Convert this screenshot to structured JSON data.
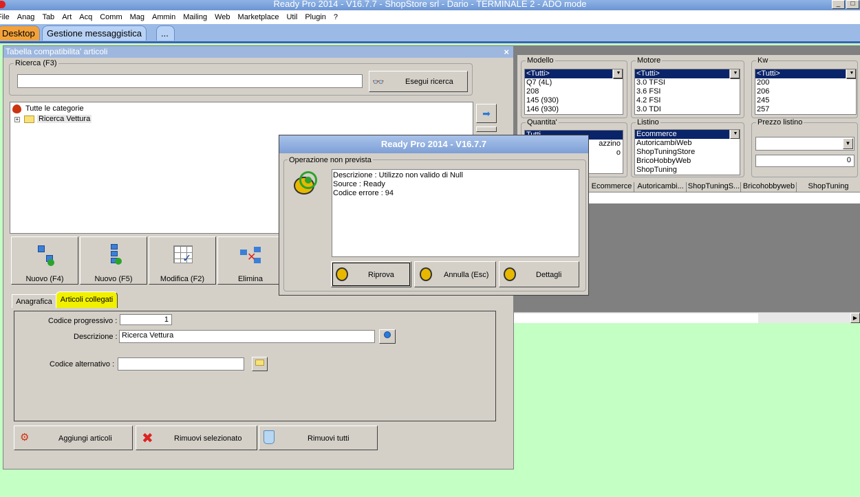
{
  "app_title": "Ready Pro 2014 - V16.7.7 - ShopStore srl - Dario - TERMINALE 2 - ADO mode",
  "menu": [
    "File",
    "Anag",
    "Tab",
    "Art",
    "Acq",
    "Comm",
    "Mag",
    "Ammin",
    "Mailing",
    "Web",
    "Marketplace",
    "Util",
    "Plugin",
    "?"
  ],
  "tabs": {
    "desktop": "Desktop",
    "messaggistica": "Gestione messaggistica",
    "more": "..."
  },
  "main_window": {
    "title": "Tabella compatibilita' articoli",
    "close": "×"
  },
  "search": {
    "group_label": "Ricerca (F3)",
    "value": "",
    "button": "Esegui ricerca"
  },
  "tree": {
    "root": "Tutte le categorie",
    "child": "Ricerca Vettura",
    "expander": "+"
  },
  "toolbar": {
    "nuovo_f4": "Nuovo (F4)",
    "nuovo_f5": "Nuovo (F5)",
    "modifica": "Modifica (F2)",
    "elimina": "Elimina"
  },
  "detail_tabs": {
    "anagrafica": "Anagrafica",
    "articoli_collegati": "Articoli collegati"
  },
  "form": {
    "codice_progressivo_label": "Codice progressivo :",
    "codice_progressivo_value": "1",
    "descrizione_label": "Descrizione :",
    "descrizione_value": "Ricerca Vettura",
    "codice_alternativo_label": "Codice alternativo :",
    "codice_alternativo_value": ""
  },
  "bottom_buttons": {
    "aggiungi": "Aggiungi articoli",
    "rimuovi_sel": "Rimuovi selezionato",
    "rimuovi_tutti": "Rimuovi tutti"
  },
  "filters": {
    "modello": {
      "label": "Modello",
      "items": [
        "<Tutti>",
        "Q7 (4L)",
        "208",
        "145 (930)",
        "146 (930)"
      ]
    },
    "motore": {
      "label": "Motore",
      "items": [
        "<Tutti>",
        "3.0 TFSI",
        "3.6 FSI",
        "4.2 FSI",
        "3.0 TDI"
      ]
    },
    "kw": {
      "label": "Kw",
      "items": [
        "<Tutti>",
        "200",
        "206",
        "245",
        "257"
      ]
    },
    "quantita": {
      "label": "Quantita'",
      "items": [
        "Tutti",
        "azzino",
        "o"
      ]
    },
    "listino": {
      "label": "Listino",
      "items": [
        "Ecommerce",
        "AutoricambiWeb",
        "ShopTuningStore",
        "BricoHobbyWeb",
        "ShopTuning"
      ]
    },
    "prezzo": {
      "label": "Prezzo listino",
      "value": "0"
    }
  },
  "grid_headers": [
    "Ecommerce",
    "Autoricambi...",
    "ShopTuningS...",
    "Bricohobbyweb",
    "ShopTuning"
  ],
  "dialog": {
    "title": "Ready Pro 2014 - V16.7.7",
    "group_label": "Operazione non prevista",
    "lines": [
      "Descrizione : Utilizzo non valido di Null",
      "Source : Ready",
      "Codice errore : 94"
    ],
    "riprova": "Riprova",
    "annulla": "Annulla (Esc)",
    "dettagli": "Dettagli"
  },
  "colors": {
    "desktop_bg": "#c4ffc4",
    "tab_active": "#f3a23b",
    "selection": "#0a246a",
    "highlight": "#f0f000"
  }
}
